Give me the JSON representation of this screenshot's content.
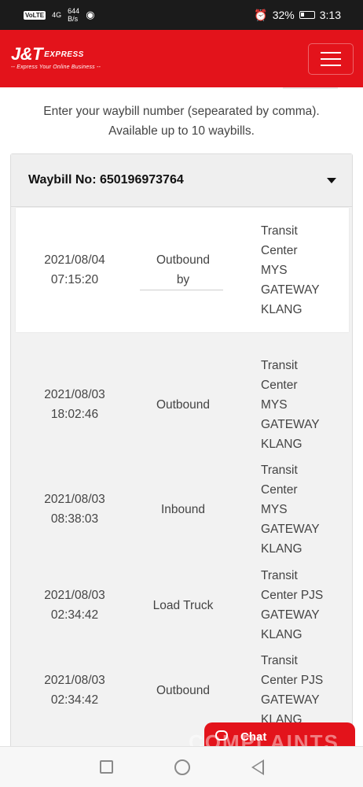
{
  "status_bar": {
    "volte": "VoLTE",
    "signal": "4G",
    "net_speed_value": "644",
    "net_speed_unit": "B/s",
    "battery": "32%",
    "time": "3:13"
  },
  "header": {
    "brand": "J&T",
    "brand_sub": "EXPRESS",
    "tagline": "-- Express Your Online Business --",
    "brand_color": "#e3131b"
  },
  "intro": {
    "line1": "Enter your waybill number (sepearated by comma).",
    "line2": "Available up to 10 waybills."
  },
  "waybill": {
    "label": "Waybill No: 650196973764"
  },
  "events": [
    {
      "date": "2021/08/04",
      "time": "07:15:20",
      "status_l1": "Outbound",
      "status_l2": "by",
      "location": [
        "Transit",
        "Center",
        "MYS",
        "GATEWAY",
        "KLANG"
      ]
    },
    {
      "date": "2021/08/03",
      "time": "18:02:46",
      "status_l1": "Outbound",
      "status_l2": "",
      "location": [
        "Transit",
        "Center",
        "MYS",
        "GATEWAY",
        "KLANG"
      ]
    },
    {
      "date": "2021/08/03",
      "time": "08:38:03",
      "status_l1": "Inbound",
      "status_l2": "",
      "location": [
        "Transit",
        "Center",
        "MYS",
        "GATEWAY",
        "KLANG"
      ]
    },
    {
      "date": "2021/08/03",
      "time": "02:34:42",
      "status_l1": "Load Truck",
      "status_l2": "",
      "location": [
        "Transit",
        "Center PJS",
        "GATEWAY",
        "KLANG"
      ]
    },
    {
      "date": "2021/08/03",
      "time": "02:34:42",
      "status_l1": "Outbound",
      "status_l2": "",
      "location": [
        "Transit",
        "Center PJS",
        "GATEWAY",
        "KLANG"
      ]
    }
  ],
  "chat": {
    "label": "Chat"
  },
  "watermark": "COMPLAINTS"
}
